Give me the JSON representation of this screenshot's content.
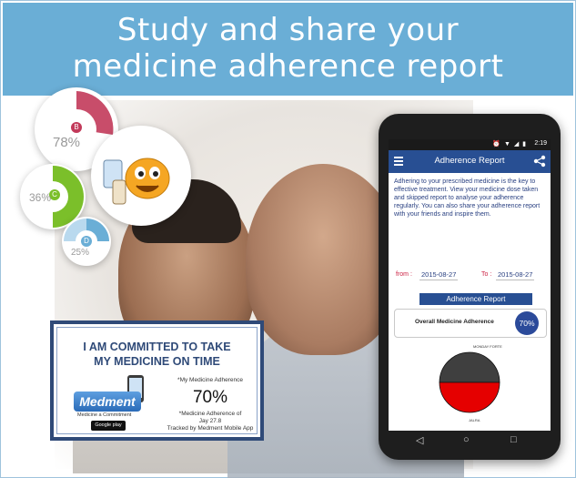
{
  "header": {
    "line1": "Study and share your",
    "line2": "medicine adherence report"
  },
  "circles": [
    {
      "label": "78%",
      "badge": "B",
      "color": "#c23a5a"
    },
    {
      "label": "36%",
      "badge": "C",
      "color": "#7bbf2a"
    },
    {
      "label": "25%",
      "badge": "D",
      "color": "#6aaed6"
    }
  ],
  "card": {
    "title_line1": "I AM COMMITTED TO TAKE",
    "title_line2": "MY MEDICINE ON TIME",
    "my_adherence_label": "*My Medicine Adherence",
    "my_adherence_value": "70%",
    "footnote_line1": "*Medicine Adherence of",
    "footnote_line2": "Jay 27.8",
    "footnote_line3": "Tracked by Medment Mobile App",
    "brand_name": "Medment",
    "brand_tagline": "Medicine a Commitment",
    "store_badge": "Google play"
  },
  "phone": {
    "status_time": "2:19",
    "status_icons": "⏰ ▼ ◢ ▮",
    "title": "Adherence Report",
    "description": "Adhering to your prescribed medicine is the key to effective treatment. View your medicine dose taken and skipped report to analyse your adherence regularly. You can also share your adherence report with your friends and inspire them.",
    "from_label": "from :",
    "from_value": "2015-08-27",
    "to_label": "To :",
    "to_value": "2015-08-27",
    "report_button": "Adherence Report",
    "overall_label": "Overall Medicine Adherence",
    "overall_value": "70%",
    "pie_label_top": "MONDAY FORTE",
    "pie_label_bottom": "JALRA",
    "colors": {
      "appbar": "#284f93",
      "pie_top": "#3f3f3f",
      "pie_bottom": "#e50000"
    }
  },
  "chart_data": {
    "type": "pie",
    "categories": [
      "MONDAY FORTE",
      "JALRA"
    ],
    "values": [
      50,
      50
    ],
    "colors": [
      "#3f3f3f",
      "#e50000"
    ]
  }
}
